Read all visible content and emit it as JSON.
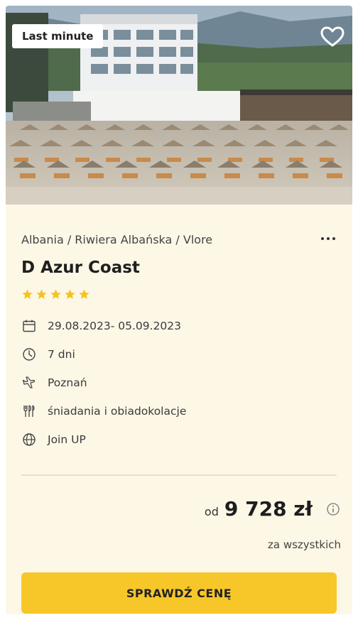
{
  "badge": {
    "label": "Last minute"
  },
  "favorite": {
    "icon": "heart-icon",
    "active": false
  },
  "breadcrumb": "Albania / Riwiera Albańska / Vlore",
  "more_menu": {
    "icon": "more-dots-icon"
  },
  "hotel": {
    "name": "D Azur Coast",
    "stars": 5,
    "star_color": "#f5c31c"
  },
  "details": [
    {
      "icon": "calendar-icon",
      "text": "29.08.2023- 05.09.2023"
    },
    {
      "icon": "clock-icon",
      "text": "7 dni"
    },
    {
      "icon": "airplane-icon",
      "text": "Poznań"
    },
    {
      "icon": "cutlery-icon",
      "text": "śniadania i obiadokolacje"
    },
    {
      "icon": "globe-icon",
      "text": "Join UP"
    }
  ],
  "price": {
    "prefix": "od",
    "value": "9 728 zł",
    "note": "za wszystkich",
    "info_icon": "info-icon"
  },
  "cta": {
    "label": "SPRAWDŹ CENĘ",
    "color": "#f7c629"
  },
  "colors": {
    "card_bg": "#fdf7e6",
    "divider": "#e6e0cd"
  }
}
